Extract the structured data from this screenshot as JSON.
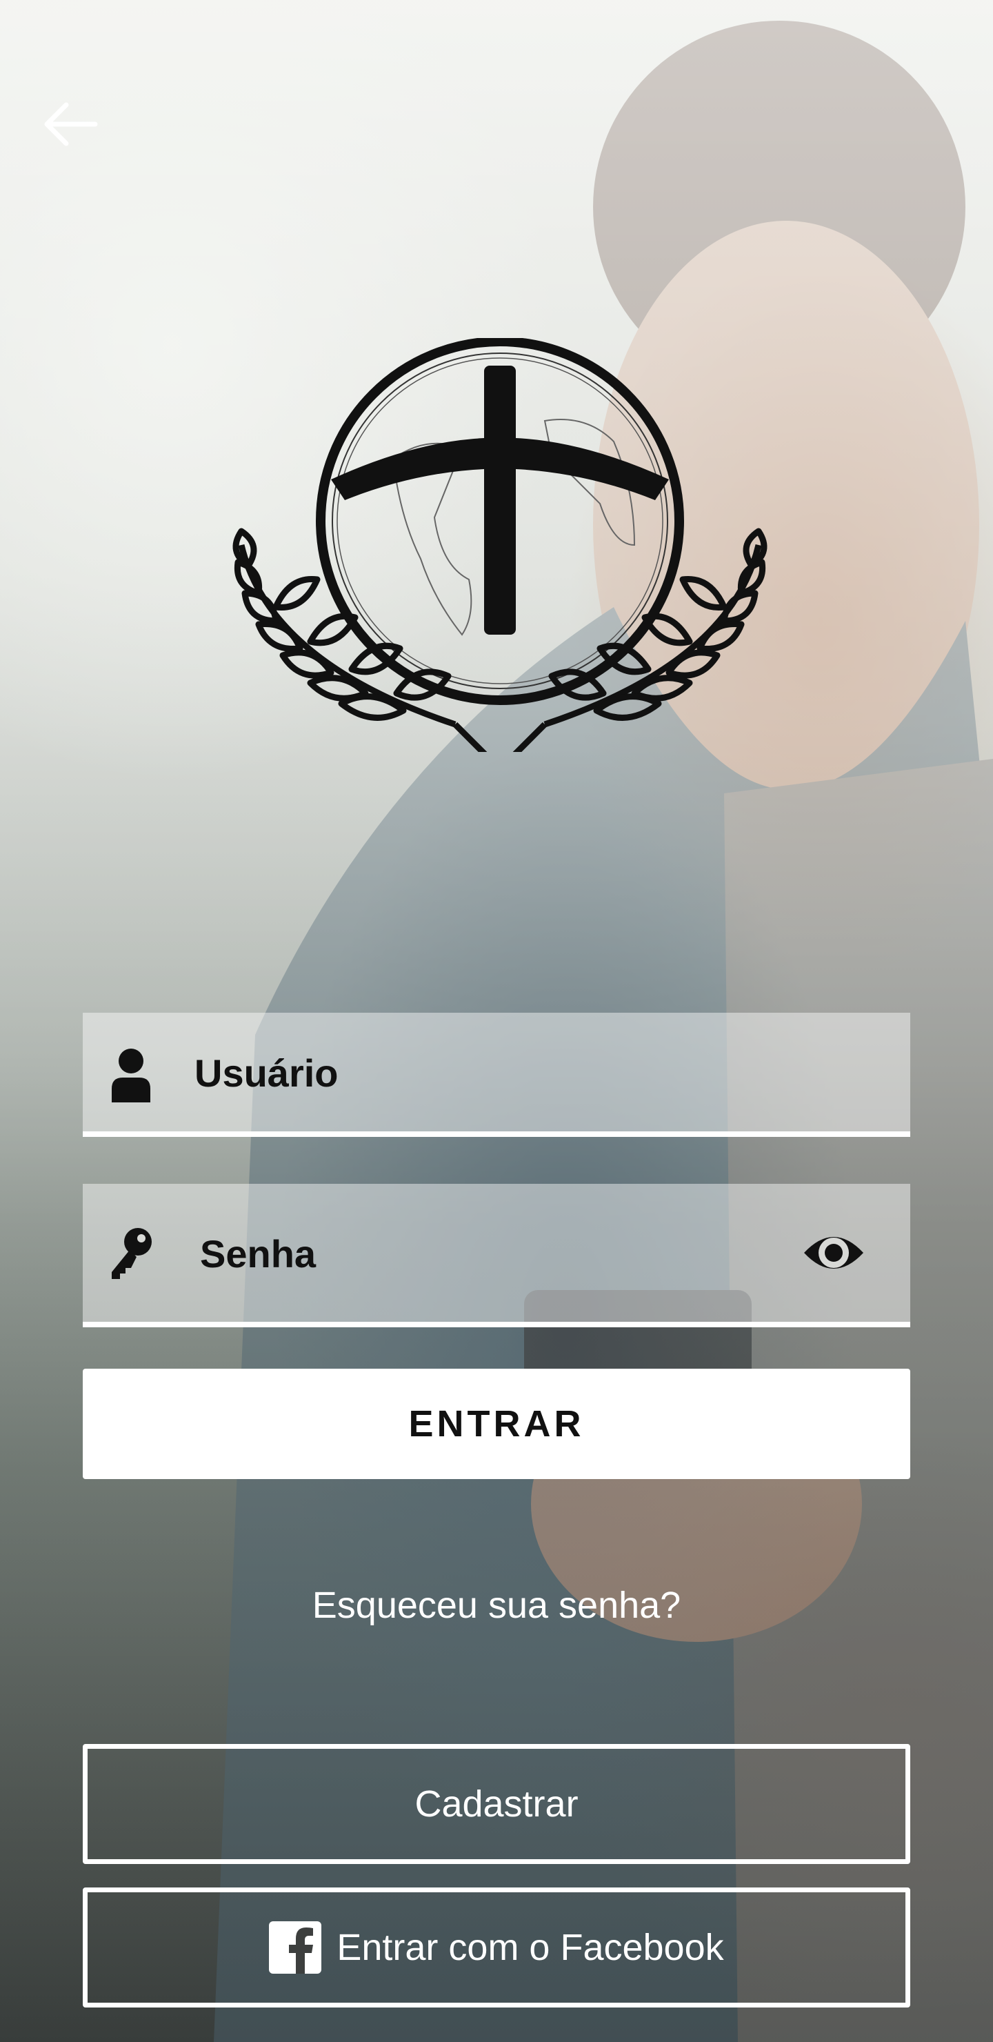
{
  "header": {
    "back_icon": "arrow-left-icon"
  },
  "logo": {
    "icon": "cross-globe-laurel-icon"
  },
  "login_form": {
    "username": {
      "icon": "user-icon",
      "placeholder": "Usuário",
      "value": ""
    },
    "password": {
      "icon": "key-icon",
      "placeholder": "Senha",
      "value": "",
      "toggle_icon": "eye-icon"
    },
    "submit_label": "ENTRAR"
  },
  "forgot_password_label": "Esqueceu sua senha?",
  "register_label": "Cadastrar",
  "facebook": {
    "icon": "facebook-icon",
    "label": "Entrar com o Facebook"
  },
  "colors": {
    "field_underline": "#ffffff",
    "button_bg": "#ffffff",
    "text_dark": "#111111",
    "text_light": "#ffffff"
  }
}
